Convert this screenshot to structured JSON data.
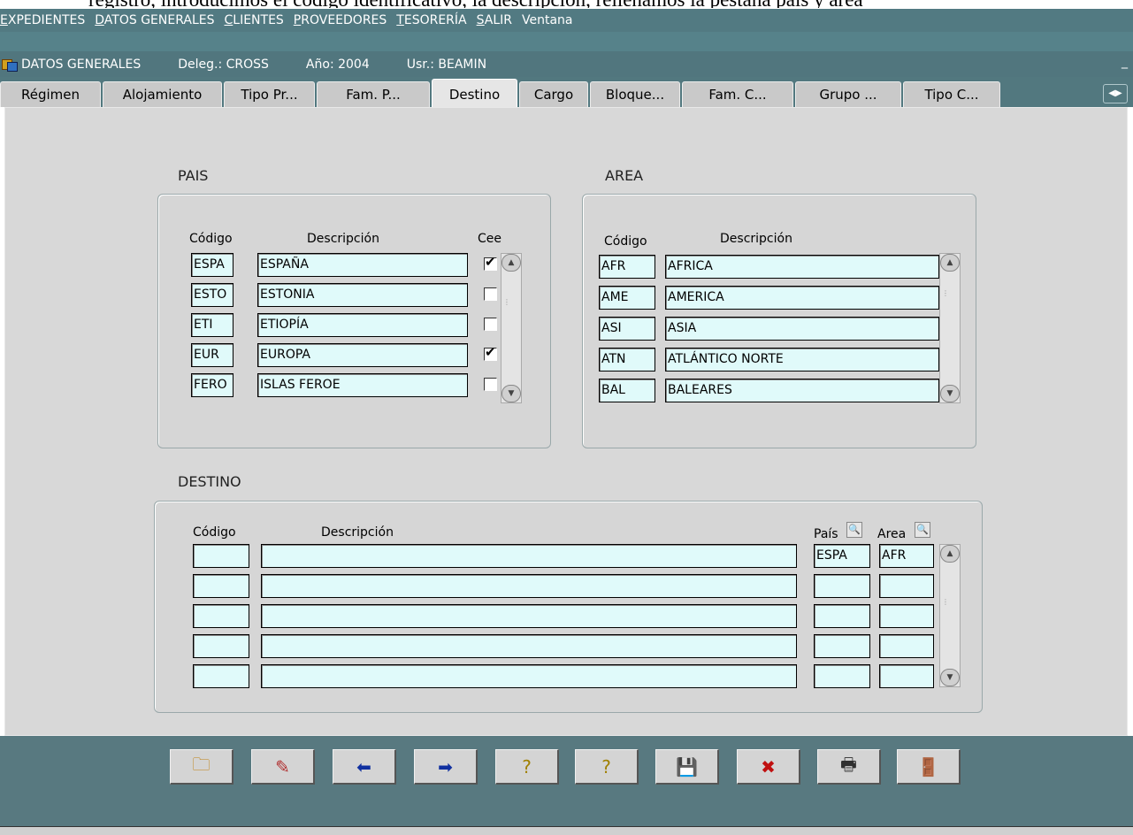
{
  "doc_text": "registro, introducimos el código identificativo, la descripción, rellenamos la pestaña país y área",
  "menu": [
    {
      "key": "E",
      "rest": "XPEDIENTES"
    },
    {
      "key": "D",
      "rest": "ATOS GENERALES"
    },
    {
      "key": "C",
      "rest": "LIENTES"
    },
    {
      "key": "P",
      "rest": "ROVEEDORES"
    },
    {
      "key": "T",
      "rest": "ESORERÍA"
    },
    {
      "key": "S",
      "rest": "ALIR"
    },
    {
      "key": "",
      "rest": "Ventana"
    }
  ],
  "titlebar": {
    "title": "DATOS GENERALES",
    "deleg": "Deleg.: CROSS",
    "year": "Año: 2004",
    "user": "Usr.: BEAMIN",
    "minimize_glyph": "_"
  },
  "tabs": [
    "Régimen",
    "Alojamiento",
    "Tipo Pr...",
    "Fam. P...",
    "Destino",
    "Cargo",
    "Bloque...",
    "Fam. C...",
    "Grupo ...",
    "Tipo C..."
  ],
  "active_tab": "Destino",
  "pais": {
    "title": "PAIS",
    "headers": {
      "codigo": "Código",
      "descripcion": "Descripción",
      "cee": "Cee"
    },
    "rows": [
      {
        "codigo": "ESPA",
        "descripcion": "ESPAÑA",
        "cee": true
      },
      {
        "codigo": "ESTO",
        "descripcion": "ESTONIA",
        "cee": false
      },
      {
        "codigo": "ETI",
        "descripcion": "ETIOPÍA",
        "cee": false
      },
      {
        "codigo": "EUR",
        "descripcion": "EUROPA",
        "cee": true
      },
      {
        "codigo": "FERO",
        "descripcion": "ISLAS FEROE",
        "cee": false
      }
    ]
  },
  "area": {
    "title": "AREA",
    "headers": {
      "codigo": "Código",
      "descripcion": "Descripción"
    },
    "rows": [
      {
        "codigo": "AFR",
        "descripcion": "AFRICA"
      },
      {
        "codigo": "AME",
        "descripcion": "AMERICA"
      },
      {
        "codigo": "ASI",
        "descripcion": "ASIA"
      },
      {
        "codigo": "ATN",
        "descripcion": "ATLÁNTICO NORTE"
      },
      {
        "codigo": "BAL",
        "descripcion": "BALEARES"
      }
    ]
  },
  "destino": {
    "title": "DESTINO",
    "headers": {
      "codigo": "Código",
      "descripcion": "Descripción",
      "pais": "País",
      "area": "Area"
    },
    "rows": [
      {
        "codigo": "",
        "descripcion": "",
        "pais": "ESPA",
        "area": "AFR"
      },
      {
        "codigo": "",
        "descripcion": "",
        "pais": "",
        "area": ""
      },
      {
        "codigo": "",
        "descripcion": "",
        "pais": "",
        "area": ""
      },
      {
        "codigo": "",
        "descripcion": "",
        "pais": "",
        "area": ""
      },
      {
        "codigo": "",
        "descripcion": "",
        "pais": "",
        "area": ""
      }
    ]
  },
  "toolbar": [
    {
      "name": "new-record-icon",
      "glyph": "🗀",
      "color": "#c08010"
    },
    {
      "name": "edit-icon",
      "glyph": "✎",
      "color": "#b03030"
    },
    {
      "name": "previous-icon",
      "glyph": "⬅",
      "color": "#1030a0"
    },
    {
      "name": "next-icon",
      "glyph": "➡",
      "color": "#1030a0"
    },
    {
      "name": "query-icon",
      "glyph": "?",
      "color": "#a08000"
    },
    {
      "name": "execute-query-icon",
      "glyph": "?",
      "color": "#a08000"
    },
    {
      "name": "save-icon",
      "glyph": "💾",
      "color": "#1030c0"
    },
    {
      "name": "delete-icon",
      "glyph": "✖",
      "color": "#c01010"
    },
    {
      "name": "print-icon",
      "glyph": "🖶",
      "color": "#303030"
    },
    {
      "name": "exit-icon",
      "glyph": "🚪",
      "color": "#806010"
    }
  ]
}
